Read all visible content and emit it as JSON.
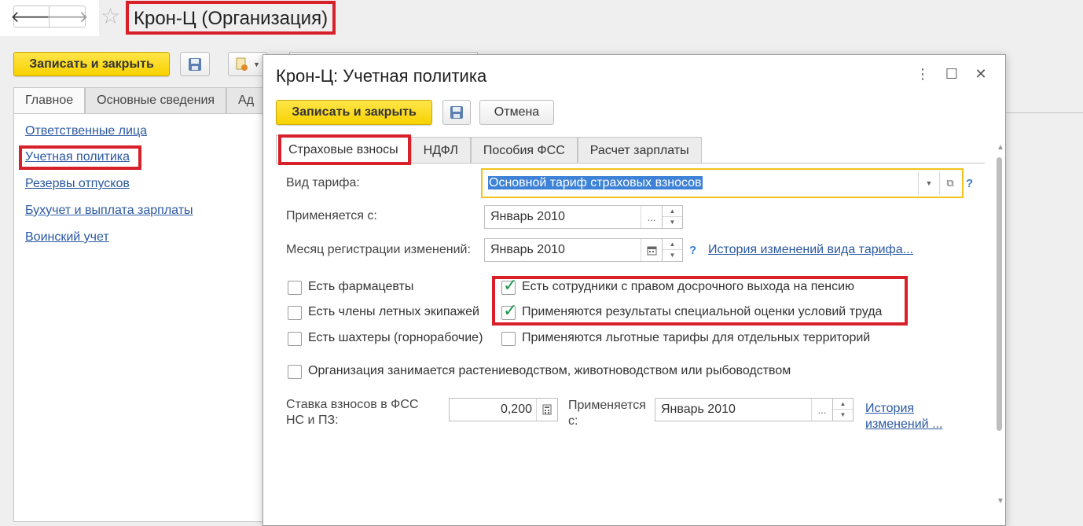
{
  "org_window": {
    "title": "Крон-Ц (Организация)",
    "save_close_label": "Записать и закрыть",
    "tabs": [
      "Главное",
      "Основные сведения",
      "Ад"
    ],
    "left_links": [
      "Ответственные лица",
      "Учетная политика",
      "Резервы отпусков",
      "Бухучет и выплата зарплаты",
      "Воинский учет"
    ]
  },
  "icons": {
    "back": "arrow-left-icon",
    "forward": "arrow-right-icon",
    "favorite": "star-icon",
    "save": "floppy-disk-icon",
    "report": "report-icon",
    "more": "more-vertical-icon",
    "maximize": "maximize-icon",
    "close": "close-icon",
    "calendar": "calendar-icon",
    "calculator": "calculator-icon",
    "open": "open-in-window-icon"
  },
  "dialog": {
    "title": "Крон-Ц: Учетная политика",
    "save_close_label": "Записать и закрыть",
    "cancel_label": "Отмена",
    "tabs": [
      "Страховые взносы",
      "НДФЛ",
      "Пособия ФСС",
      "Расчет зарплаты"
    ],
    "active_tab": "Страховые взносы",
    "tariff": {
      "label": "Вид тарифа:",
      "value": "Основной тариф страховых взносов",
      "help": "?"
    },
    "applies_from": {
      "label": "Применяется с:",
      "value": "Январь 2010",
      "btn": "..."
    },
    "reg_month": {
      "label": "Месяц регистрации изменений:",
      "value": "Январь 2010",
      "help": "?",
      "history_link": "История изменений вида тарифа..."
    },
    "checkboxes": {
      "pharmacists": {
        "label": "Есть фармацевты",
        "checked": false
      },
      "aircrew": {
        "label": "Есть члены летных экипажей",
        "checked": false
      },
      "miners": {
        "label": "Есть шахтеры (горнорабочие)",
        "checked": false
      },
      "early_pension": {
        "label": "Есть сотрудники с правом досрочного выхода на пенсию",
        "checked": true
      },
      "special_assessment": {
        "label": "Применяются результаты специальной оценки условий труда",
        "checked": true
      },
      "preferential_tariffs": {
        "label": "Применяются льготные тарифы для отдельных территорий",
        "checked": false
      },
      "agriculture": {
        "label": "Организация занимается растениеводством, животноводством или рыбоводством",
        "checked": false
      }
    },
    "fss_rate": {
      "label_line1": "Ставка взносов в ФСС",
      "label_line2": "НС и ПЗ:",
      "value": "0,200",
      "applies_label_line1": "Применяется",
      "applies_label_line2": "с:",
      "applies_value": "Январь 2010",
      "btn": "...",
      "history_line1": "История",
      "history_line2": "изменений ..."
    }
  },
  "colors": {
    "highlight": "#d7202a",
    "primary_button": "#f7d200",
    "link": "#2a58a2",
    "selection": "#3d82d6",
    "checkmark": "#1f9a4a",
    "focus_border": "#f0c419"
  }
}
